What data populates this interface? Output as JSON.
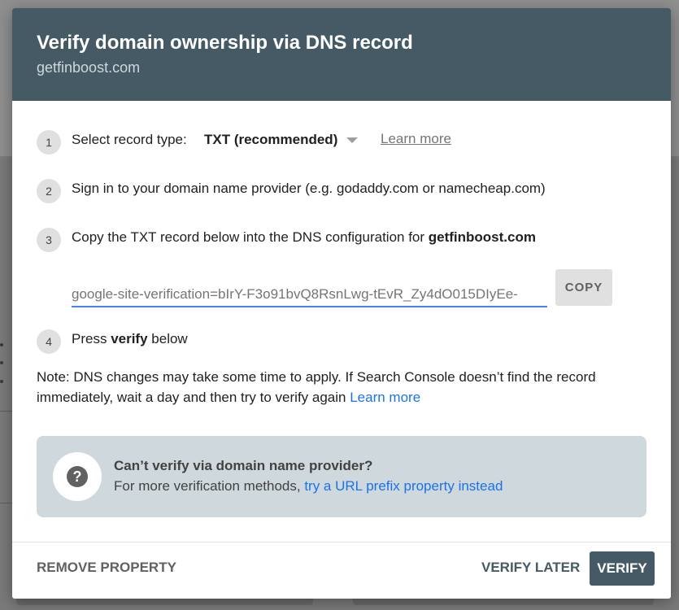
{
  "dialog": {
    "title": "Verify domain ownership via DNS record",
    "subtitle": "getfinboost.com"
  },
  "steps": [
    {
      "number": "1",
      "label": "Select record type:",
      "select_value": "TXT (recommended)",
      "link": "Learn more"
    },
    {
      "number": "2",
      "text": "Sign in to your domain name provider (e.g. godaddy.com or namecheap.com)"
    },
    {
      "number": "3",
      "text_prefix": "Copy the TXT record below into the DNS configuration for ",
      "domain": "getfinboost.com"
    },
    {
      "number": "4",
      "text_prefix": "Press ",
      "bold": "verify",
      "text_suffix": " below"
    }
  ],
  "record": {
    "value": "google-site-verification=bIrY-F3o91bvQ8RsnLwg-tEvR_Zy4dO015DIyEe-",
    "copy_label": "COPY"
  },
  "note": {
    "text": "Note: DNS changes may take some time to apply. If Search Console doesn’t find the record immediately, wait a day and then try to verify again ",
    "link": "Learn more"
  },
  "alt_panel": {
    "icon": "help-icon",
    "icon_glyph": "?",
    "title": "Can’t verify via domain name provider?",
    "desc_prefix": "For more verification methods, ",
    "desc_link": "try a URL prefix property instead"
  },
  "footer": {
    "remove_label": "REMOVE PROPERTY",
    "later_label": "VERIFY LATER",
    "verify_label": "VERIFY"
  },
  "colors": {
    "header_bg": "#455a64",
    "link_blue": "#1a73e8",
    "panel_bg": "#cfd8dc",
    "primary_button": "#455a64"
  }
}
